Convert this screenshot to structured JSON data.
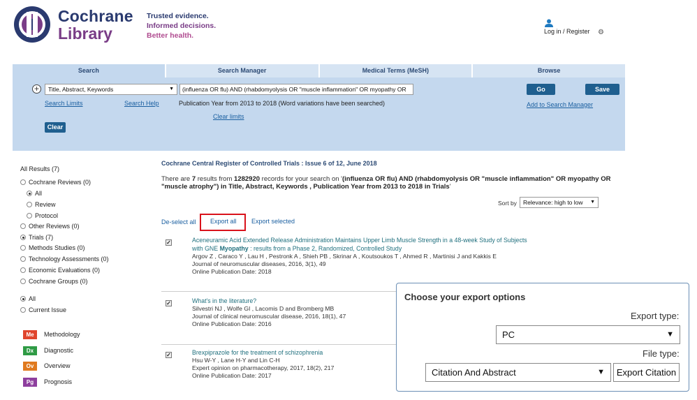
{
  "header": {
    "logo_line1": "Cochrane",
    "logo_line2": "Library",
    "tagline1": "Trusted evidence.",
    "tagline2": "Informed decisions.",
    "tagline3": "Better health.",
    "login_label": "Log in / Register",
    "brand_colors": {
      "navy": "#2a3a6f",
      "purple": "#7a3d87",
      "pink": "#b04c90"
    }
  },
  "search": {
    "tabs": [
      "Search",
      "Search Manager",
      "Medical Terms (MeSH)",
      "Browse"
    ],
    "field_select": "Title, Abstract, Keywords",
    "query": "(influenza OR flu) AND (rhabdomyolysis OR \"muscle inflammation\" OR myopathy OR",
    "go_label": "Go",
    "save_label": "Save",
    "search_limits": "Search Limits",
    "search_help": "Search Help",
    "pub_year_note": "Publication Year from 2013 to 2018 (Word variations have been searched)",
    "add_to_manager": "Add to Search Manager",
    "clear_limits": "Clear limits",
    "clear_label": "Clear"
  },
  "sidebar": {
    "all_results": "All Results (7)",
    "cochrane_reviews": "Cochrane Reviews (0)",
    "all": "All",
    "review": "Review",
    "protocol": "Protocol",
    "other_reviews": "Other Reviews (0)",
    "trials": "Trials (7)",
    "methods_studies": "Methods Studies (0)",
    "technology_assessments": "Technology Assessments (0)",
    "economic_evaluations": "Economic Evaluations (0)",
    "cochrane_groups": "Cochrane Groups (0)",
    "scope_all": "All",
    "current_issue": "Current Issue",
    "legend": [
      {
        "code": "Me",
        "label": "Methodology",
        "color": "#e0452d"
      },
      {
        "code": "Dx",
        "label": "Diagnostic",
        "color": "#2f9b45"
      },
      {
        "code": "Ov",
        "label": "Overview",
        "color": "#e07a1f"
      },
      {
        "code": "Pg",
        "label": "Prognosis",
        "color": "#8e3f9e"
      }
    ]
  },
  "results": {
    "register_title": "Cochrane Central Register of Controlled Trials : Issue 6 of 12, June 2018",
    "summary_pre": "There are ",
    "count": "7",
    "summary_mid1": " results from ",
    "total": "1282920",
    "summary_mid2": " records for your search on '",
    "query_bold": "(influenza OR flu) AND (rhabdomyolysis OR \"muscle inflammation\" OR myopathy OR \"muscle atrophy\") in Title, Abstract, Keywords , Publication Year from 2013 to 2018 in Trials",
    "summary_end": "'",
    "sort_label": "Sort by",
    "sort_value": "Relevance: high to low",
    "deselect_all": "De-select all",
    "export_all": "Export all",
    "export_selected": "Export selected",
    "records": [
      {
        "title1": "Aceneuramic Acid Extended Release Administration Maintains Upper Limb Muscle Strength in a 48-week Study of Subjects",
        "title2_pre": "with GNE ",
        "title2_bold": "Myopathy",
        "title2_post": " : results from a Phase 2, Randomized, Controlled Study",
        "authors": "Argov Z , Caraco Y , Lau H , Pestronk A , Shieh PB , Skrinar A , Koutsoukos T , Ahmed R , Martinisi J and Kakkis E",
        "journal": "Journal of neuromuscular diseases, 2016, 3(1), 49",
        "pubdate": "Online Publication Date: 2018"
      },
      {
        "title1": "What's in the literature?",
        "authors": "Silvestri NJ , Wolfe GI , Lacomis D and Bromberg MB",
        "journal": "Journal of clinical neuromuscular disease, 2016, 18(1), 47",
        "pubdate": "Online Publication Date: 2016"
      },
      {
        "title1": "Brexpiprazole for the treatment of schizophrenia",
        "authors": "Hsu W-Y , Lane H-Y and Lin C-H",
        "journal": "Expert opinion on pharmacotherapy, 2017, 18(2), 217",
        "pubdate": "Online Publication Date: 2017"
      }
    ]
  },
  "export_dialog": {
    "title": "Choose your export options",
    "export_type_label": "Export type:",
    "export_type_value": "PC",
    "file_type_label": "File type:",
    "file_type_value": "Citation And Abstract",
    "export_citation": "Export Citation"
  }
}
